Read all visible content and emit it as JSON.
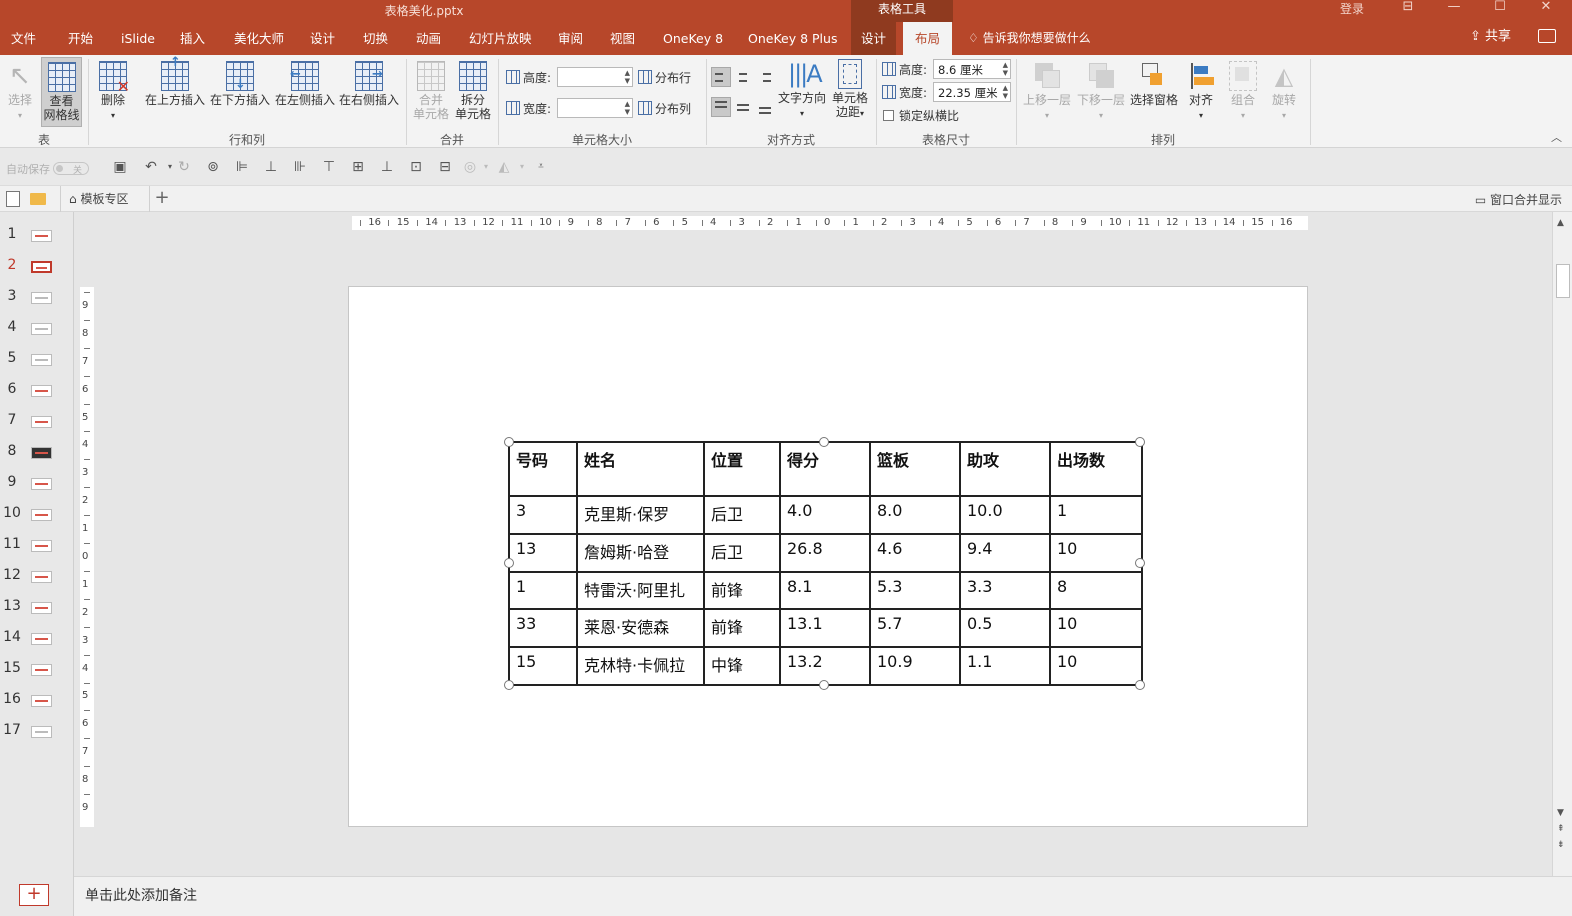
{
  "window": {
    "title": "表格美化.pptx",
    "context_group": "表格工具",
    "login": "登录",
    "controls": [
      "⊟",
      "—",
      "☐",
      "✕"
    ]
  },
  "tabs": [
    "文件",
    "开始",
    "iSlide",
    "插入",
    "美化大师",
    "设计",
    "切换",
    "动画",
    "幻灯片放映",
    "审阅",
    "视图",
    "OneKey 8",
    "OneKey 8 Plus"
  ],
  "context_tabs": {
    "design": "设计",
    "layout": "布局"
  },
  "tell_me": "告诉我你想要做什么",
  "share": "共享",
  "ribbon": {
    "table_group": {
      "label": "表",
      "select": "选择",
      "gridlines_1": "查看",
      "gridlines_2": "网格线"
    },
    "rowcol_group": {
      "label": "行和列",
      "delete": "删除",
      "insert_above": "在上方插入",
      "insert_below": "在下方插入",
      "insert_left": "在左侧插入",
      "insert_right": "在右侧插入"
    },
    "merge_group": {
      "label": "合并",
      "merge_1": "合并",
      "merge_2": "单元格",
      "split_1": "拆分",
      "split_2": "单元格"
    },
    "cellsize_group": {
      "label": "单元格大小",
      "height_label": "高度:",
      "width_label": "宽度:",
      "height_value": "",
      "width_value": "",
      "dist_rows": "分布行",
      "dist_cols": "分布列"
    },
    "align_group": {
      "label": "对齐方式",
      "text_direction": "文字方向",
      "cell_margins_1": "单元格",
      "cell_margins_2": "边距"
    },
    "tablesize_group": {
      "label": "表格尺寸",
      "height_label": "高度:",
      "width_label": "宽度:",
      "height_value": "8.6 厘米",
      "width_value": "22.35 厘米",
      "lock_ratio": "锁定纵横比"
    },
    "arrange_group": {
      "label": "排列",
      "bring_forward": "上移一层",
      "send_backward": "下移一层",
      "selection_pane": "选择窗格",
      "align": "对齐",
      "group": "组合",
      "rotate": "旋转"
    }
  },
  "qat": {
    "autosave": "自动保存",
    "autosave_state": "关"
  },
  "docbar": {
    "template_tab": "模板专区",
    "merge_windows": "窗口合并显示"
  },
  "slides": {
    "numbers": [
      "1",
      "2",
      "3",
      "4",
      "5",
      "6",
      "7",
      "8",
      "9",
      "10",
      "11",
      "12",
      "13",
      "14",
      "15",
      "16",
      "17"
    ],
    "selected": "2"
  },
  "ruler": {
    "horizontal": [
      "16",
      "15",
      "14",
      "13",
      "12",
      "11",
      "10",
      "9",
      "8",
      "7",
      "6",
      "5",
      "4",
      "3",
      "2",
      "1",
      "0",
      "1",
      "2",
      "3",
      "4",
      "5",
      "6",
      "7",
      "8",
      "9",
      "10",
      "11",
      "12",
      "13",
      "14",
      "15",
      "16"
    ],
    "vertical": [
      "9",
      "8",
      "7",
      "6",
      "5",
      "4",
      "3",
      "2",
      "1",
      "0",
      "1",
      "2",
      "3",
      "4",
      "5",
      "6",
      "7",
      "8",
      "9"
    ]
  },
  "table": {
    "headers": [
      "号码",
      "姓名",
      "位置",
      "得分",
      "篮板",
      "助攻",
      "出场数"
    ],
    "rows": [
      [
        "3",
        "克里斯·保罗",
        "后卫",
        "4.0",
        "8.0",
        "10.0",
        "1"
      ],
      [
        "13",
        "詹姆斯·哈登",
        "后卫",
        "26.8",
        "4.6",
        "9.4",
        "10"
      ],
      [
        "1",
        "特雷沃·阿里扎",
        "前锋",
        "8.1",
        "5.3",
        "3.3",
        "8"
      ],
      [
        "33",
        "莱恩·安德森",
        "前锋",
        "13.1",
        "5.7",
        "0.5",
        "10"
      ],
      [
        "15",
        "克林特·卡佩拉",
        "中锋",
        "13.2",
        "10.9",
        "1.1",
        "10"
      ]
    ]
  },
  "notes_placeholder": "单击此处添加备注",
  "colors": {
    "accent": "#b7472a",
    "context": "#8f3a1f",
    "selection": "#c0392b"
  }
}
